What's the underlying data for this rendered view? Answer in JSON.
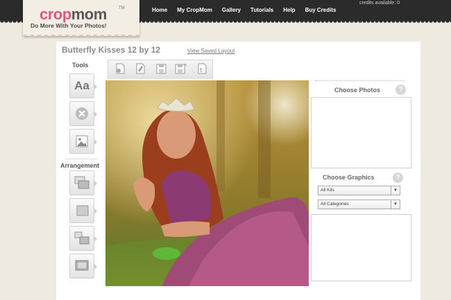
{
  "logo": {
    "crop": "crop",
    "mom": "mom",
    "tm": "TM",
    "tagline": "Do More With Your Photos!"
  },
  "nav": [
    "Home",
    "My CropMom",
    "Gallery",
    "Tutorials",
    "Help",
    "Buy Credits"
  ],
  "credits": "credits available: 0",
  "project": {
    "title": "Butterfly Kisses 12 by 12",
    "view_link": "View Saved Layout"
  },
  "tools": {
    "label": "Tools",
    "text_icon_label": "Aa"
  },
  "arrangement": {
    "label": "Arrangement"
  },
  "right": {
    "choose_photos": "Choose Photos",
    "choose_graphics": "Choose Graphics",
    "help": "?",
    "kits_selected": "All Kits",
    "categories_selected": "All Categories"
  },
  "colors": {
    "accent": "#e0567e",
    "topbar": "#2b2b2b",
    "background": "#efeae0"
  }
}
